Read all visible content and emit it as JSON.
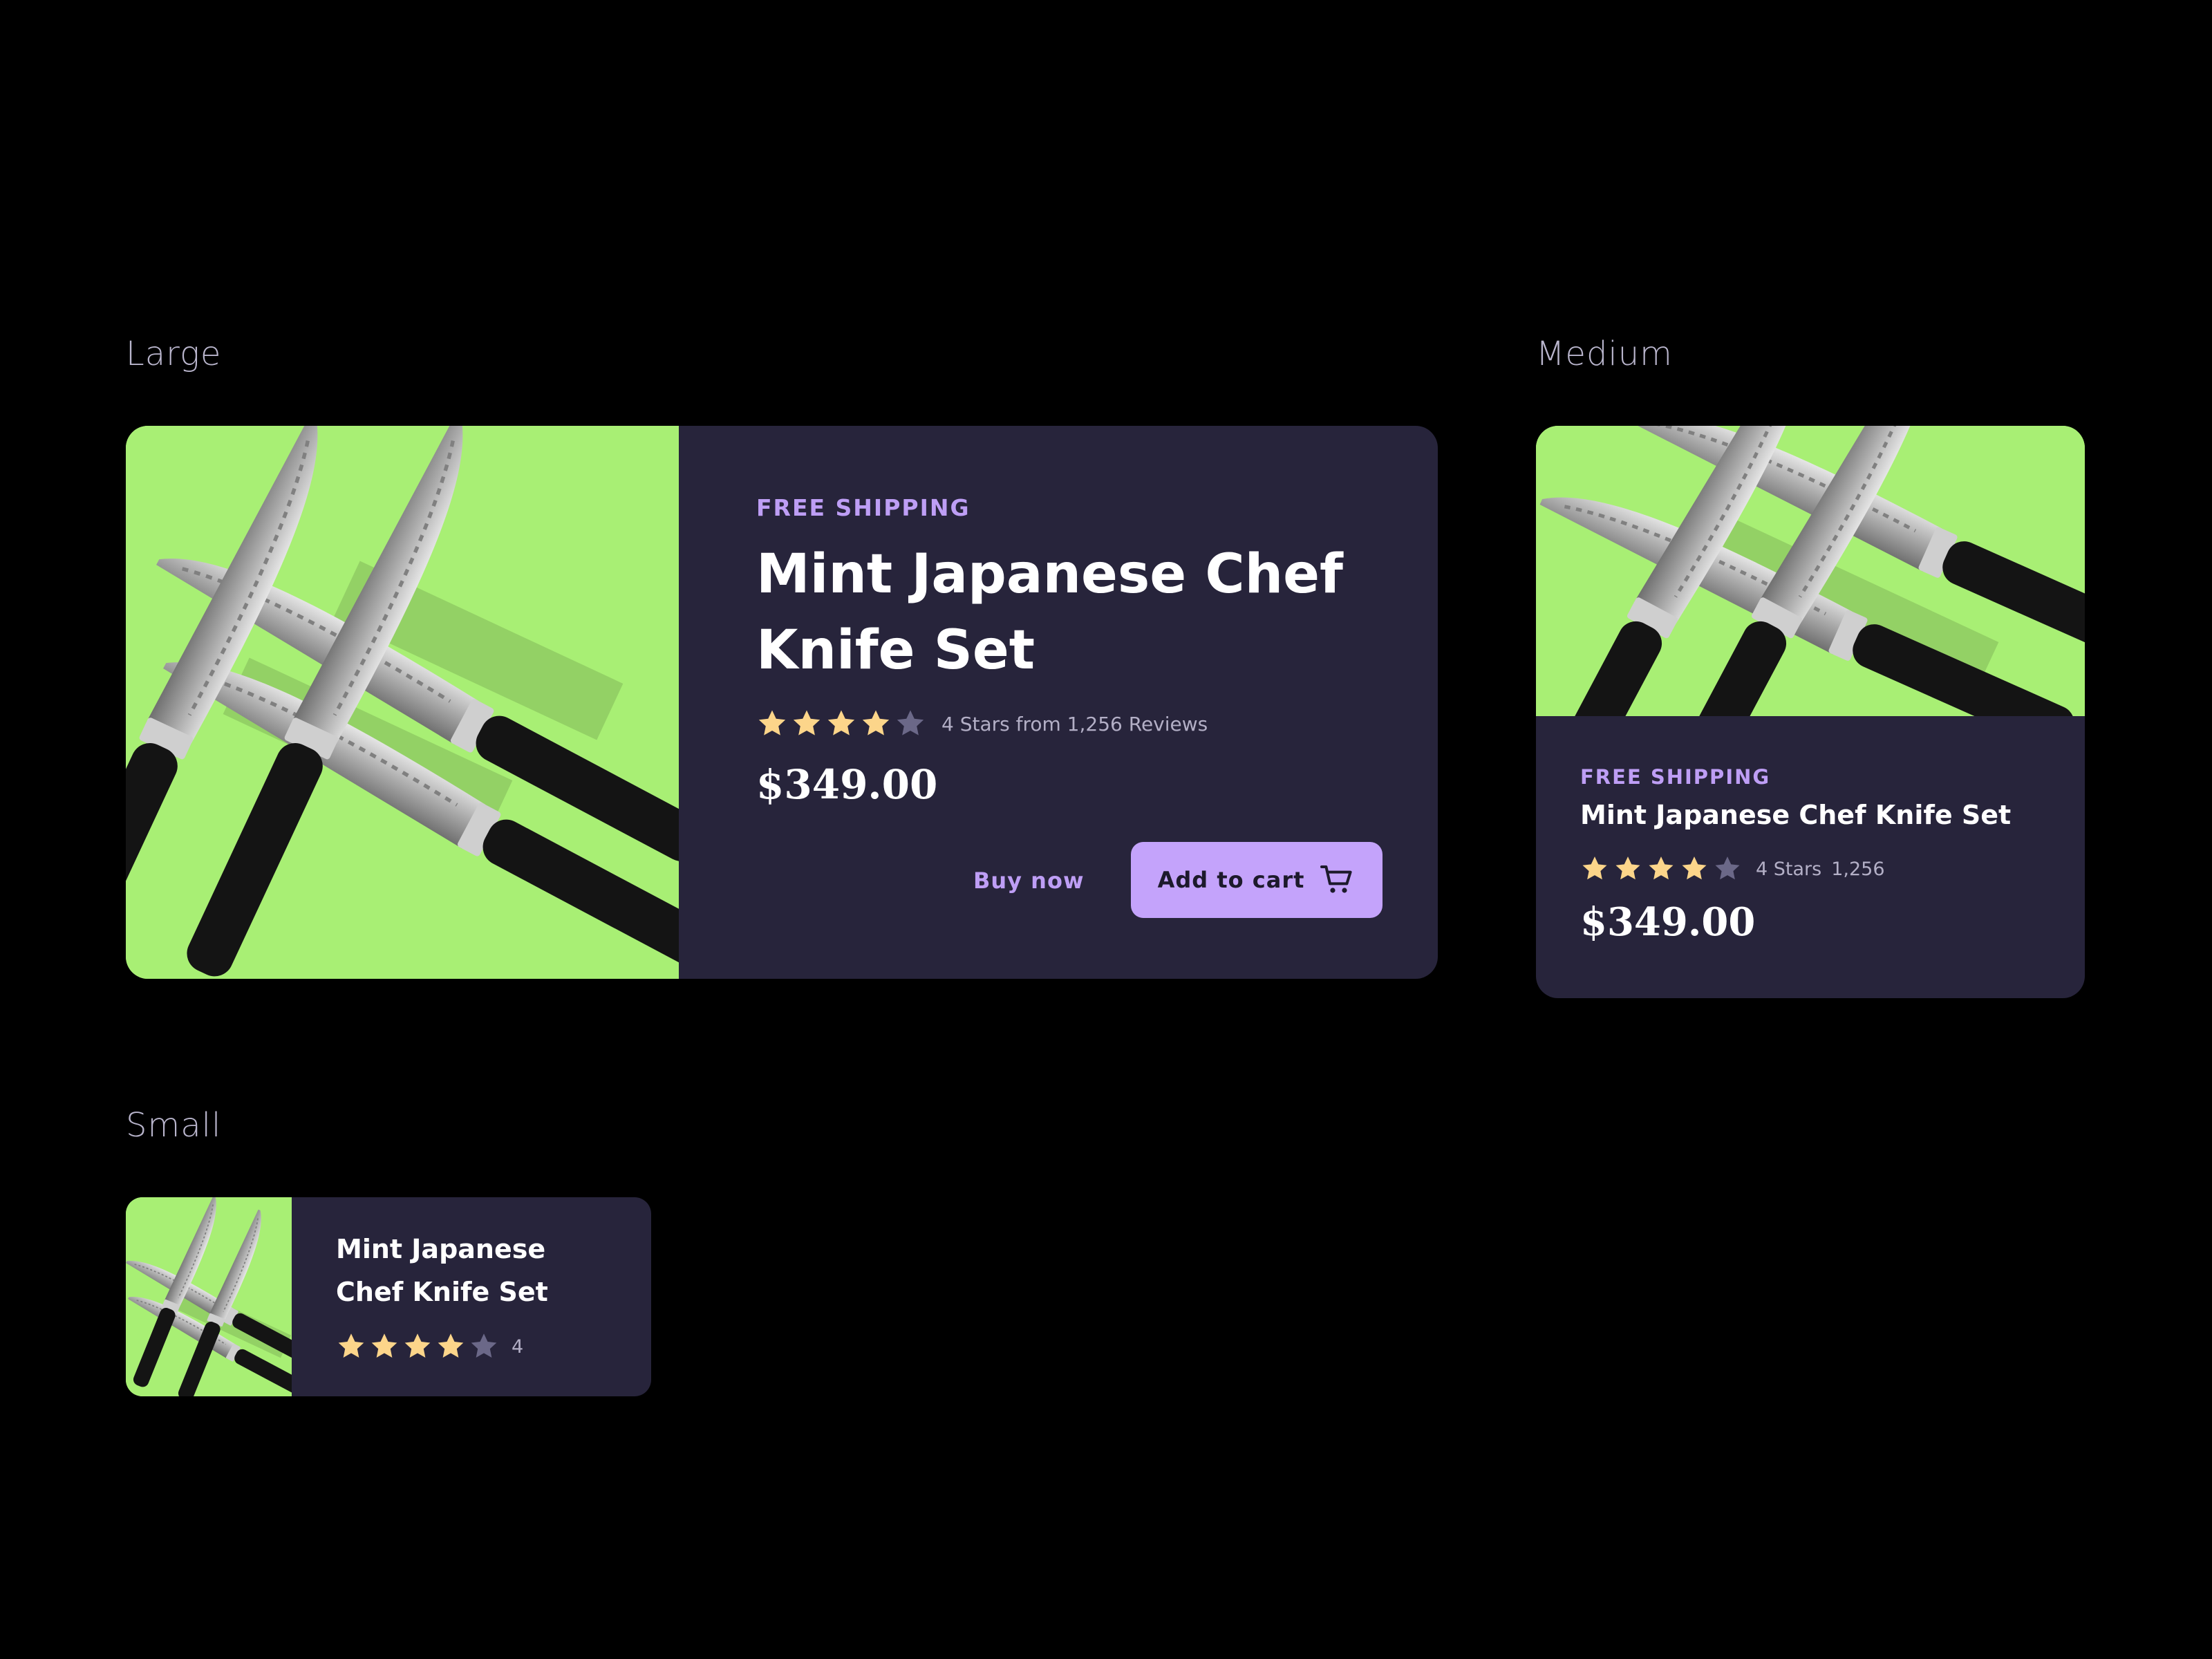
{
  "sections": {
    "large": "Large",
    "medium": "Medium",
    "small": "Small"
  },
  "product": {
    "shipping": "FREE SHIPPING",
    "name": "Mint Japanese Chef Knife Set",
    "price": "$349.00",
    "rating": 4,
    "rating_max": 5,
    "image": "knife-set-photo"
  },
  "large": {
    "title_line1": "Mint Japanese Chef",
    "title_line2": "Knife Set",
    "rating_text": "4 Stars from 1,256 Reviews",
    "buy_now": "Buy now",
    "add_to_cart": "Add to cart",
    "cart_icon": "cart-icon"
  },
  "medium": {
    "title": "Mint Japanese Chef Knife Set",
    "rating_stars_text": "4 Stars",
    "rating_count_text": "1,256"
  },
  "small": {
    "title_line1": "Mint Japanese",
    "title_line2": "Chef Knife Set",
    "rating_text": "4"
  },
  "colors": {
    "background": "#000000",
    "card": "#27243b",
    "image_bg": "#a8ef74",
    "accent": "#be9ef5",
    "button": "#c4a3fb",
    "star_filled": "#fcd58a",
    "star_empty": "#6b6888"
  }
}
